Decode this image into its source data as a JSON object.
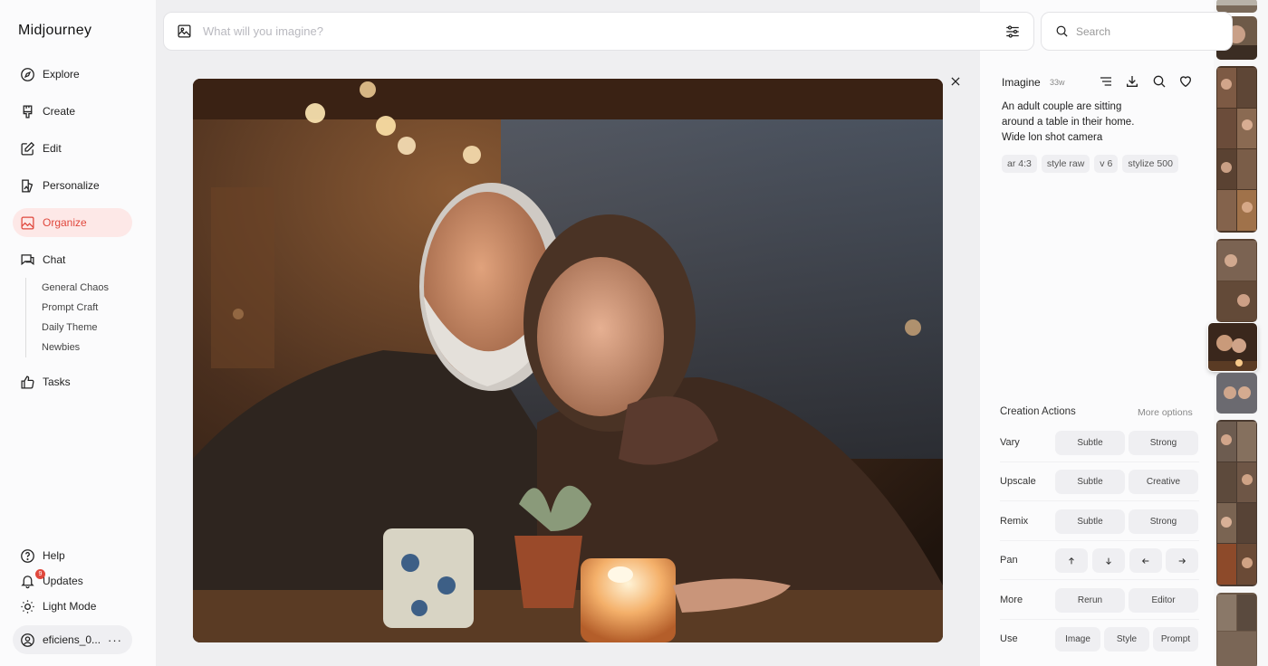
{
  "brand": "Midjourney",
  "nav": [
    {
      "label": "Explore",
      "icon": "compass-icon"
    },
    {
      "label": "Create",
      "icon": "brush-icon"
    },
    {
      "label": "Edit",
      "icon": "pencil-square-icon"
    },
    {
      "label": "Personalize",
      "icon": "personalize-icon"
    },
    {
      "label": "Organize",
      "icon": "image-folder-icon",
      "active": true
    },
    {
      "label": "Chat",
      "icon": "chat-bubble-icon"
    },
    {
      "label": "Tasks",
      "icon": "thumbs-up-icon"
    }
  ],
  "chat_rooms": [
    "General Chaos",
    "Prompt Craft",
    "Daily Theme",
    "Newbies"
  ],
  "bottom_nav": {
    "help": "Help",
    "updates": "Updates",
    "updates_badge": "9",
    "light_mode": "Light Mode"
  },
  "user": {
    "name": "eficiens_0...",
    "menu": "···"
  },
  "prompt_bar": {
    "placeholder": "What will you imagine?"
  },
  "search": {
    "placeholder": "Search"
  },
  "details": {
    "job_type": "Imagine",
    "age": "33w",
    "prompt": "An adult couple are sitting around a table in their home. Wide lon shot camera",
    "params": [
      "ar 4:3",
      "style raw",
      "v 6",
      "stylize 500"
    ]
  },
  "actions": {
    "title": "Creation Actions",
    "more_options": "More options",
    "rows": [
      {
        "label": "Vary",
        "buttons": [
          "Subtle",
          "Strong"
        ]
      },
      {
        "label": "Upscale",
        "buttons": [
          "Subtle",
          "Creative"
        ]
      },
      {
        "label": "Remix",
        "buttons": [
          "Subtle",
          "Strong"
        ]
      },
      {
        "label": "Pan",
        "buttons": [
          "arrow-up-icon",
          "arrow-down-icon",
          "arrow-left-icon",
          "arrow-right-icon"
        ]
      },
      {
        "label": "More",
        "buttons": [
          "Rerun",
          "Editor"
        ]
      },
      {
        "label": "Use",
        "buttons": [
          "Image",
          "Style",
          "Prompt"
        ]
      }
    ]
  },
  "colors": {
    "accent": "#e0483d",
    "active_bg": "#fde8e7"
  }
}
